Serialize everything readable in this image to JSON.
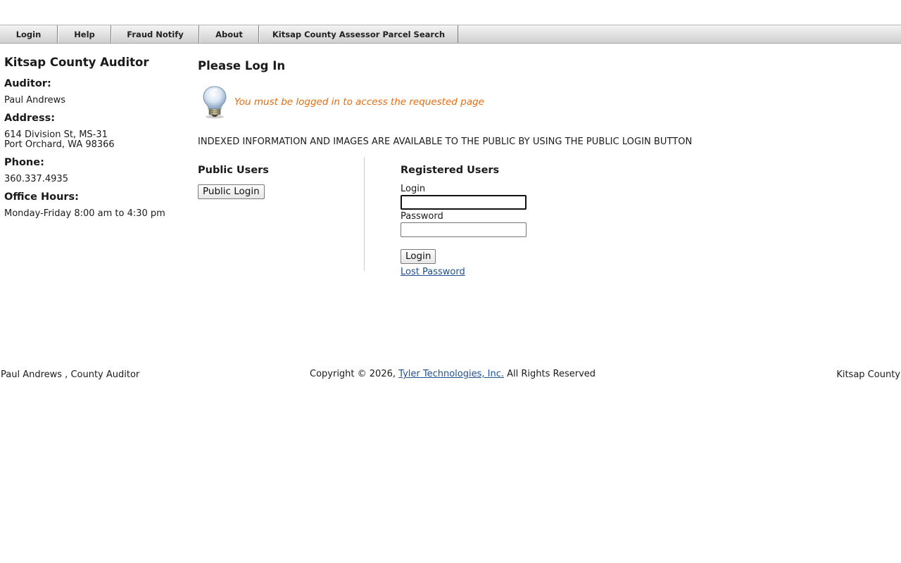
{
  "nav": {
    "items": [
      {
        "label": "Login"
      },
      {
        "label": "Help"
      },
      {
        "label": "Fraud Notify"
      },
      {
        "label": "About"
      },
      {
        "label": "Kitsap County Assessor Parcel Search"
      }
    ]
  },
  "sidebar": {
    "title": "Kitsap County Auditor",
    "auditor_heading": "Auditor:",
    "auditor_name": "Paul Andrews",
    "address_heading": "Address:",
    "address_line1": "614 Division St, MS-31",
    "address_line2": "Port Orchard, WA 98366",
    "phone_heading": "Phone:",
    "phone": "360.337.4935",
    "hours_heading": "Office Hours:",
    "hours": "Monday-Friday 8:00 am to 4:30 pm"
  },
  "main": {
    "title": "Please Log In",
    "message": "You must be logged in to access the requested page",
    "notice": "INDEXED INFORMATION AND IMAGES ARE AVAILABLE TO THE PUBLIC BY USING THE PUBLIC LOGIN BUTTON",
    "public": {
      "title": "Public Users",
      "button": "Public Login"
    },
    "registered": {
      "title": "Registered Users",
      "login_label": "Login",
      "login_value": "",
      "password_label": "Password",
      "password_value": "",
      "button": "Login",
      "lost_password": "Lost Password"
    }
  },
  "footer": {
    "left": "Paul Andrews , County Auditor",
    "copyright_prefix": "Copyright © 2026,",
    "company_link": "Tyler Technologies, Inc.",
    "copyright_suffix": "All Rights Reserved",
    "right": "Kitsap County"
  },
  "colors": {
    "message": "#e86a10",
    "link": "#1f4f8f"
  },
  "icons": {
    "message_icon": "lightbulb-icon"
  }
}
